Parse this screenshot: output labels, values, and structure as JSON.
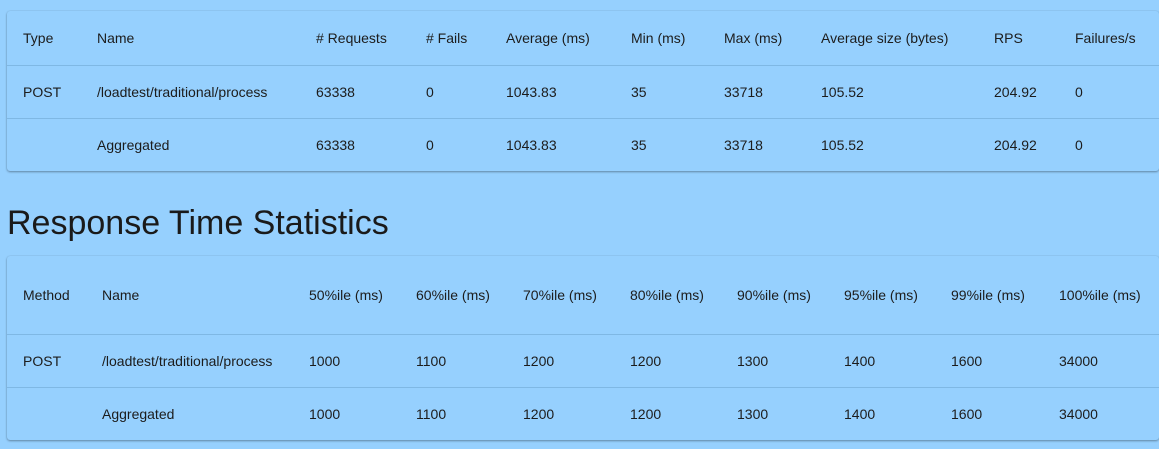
{
  "request_stats": {
    "headers": [
      "Type",
      "Name",
      "# Requests",
      "# Fails",
      "Average (ms)",
      "Min (ms)",
      "Max (ms)",
      "Average size (bytes)",
      "RPS",
      "Failures/s"
    ],
    "rows": [
      [
        "POST",
        "/loadtest/traditional/process",
        "63338",
        "0",
        "1043.83",
        "35",
        "33718",
        "105.52",
        "204.92",
        "0"
      ],
      [
        "",
        "Aggregated",
        "63338",
        "0",
        "1043.83",
        "35",
        "33718",
        "105.52",
        "204.92",
        "0"
      ]
    ]
  },
  "response_time": {
    "title": "Response Time Statistics",
    "headers": [
      "Method",
      "Name",
      "50%ile (ms)",
      "60%ile (ms)",
      "70%ile (ms)",
      "80%ile (ms)",
      "90%ile (ms)",
      "95%ile (ms)",
      "99%ile (ms)",
      "100%ile (ms)"
    ],
    "rows": [
      [
        "POST",
        "/loadtest/traditional/process",
        "1000",
        "1100",
        "1200",
        "1200",
        "1300",
        "1400",
        "1600",
        "34000"
      ],
      [
        "",
        "Aggregated",
        "1000",
        "1100",
        "1200",
        "1200",
        "1300",
        "1400",
        "1600",
        "34000"
      ]
    ]
  }
}
